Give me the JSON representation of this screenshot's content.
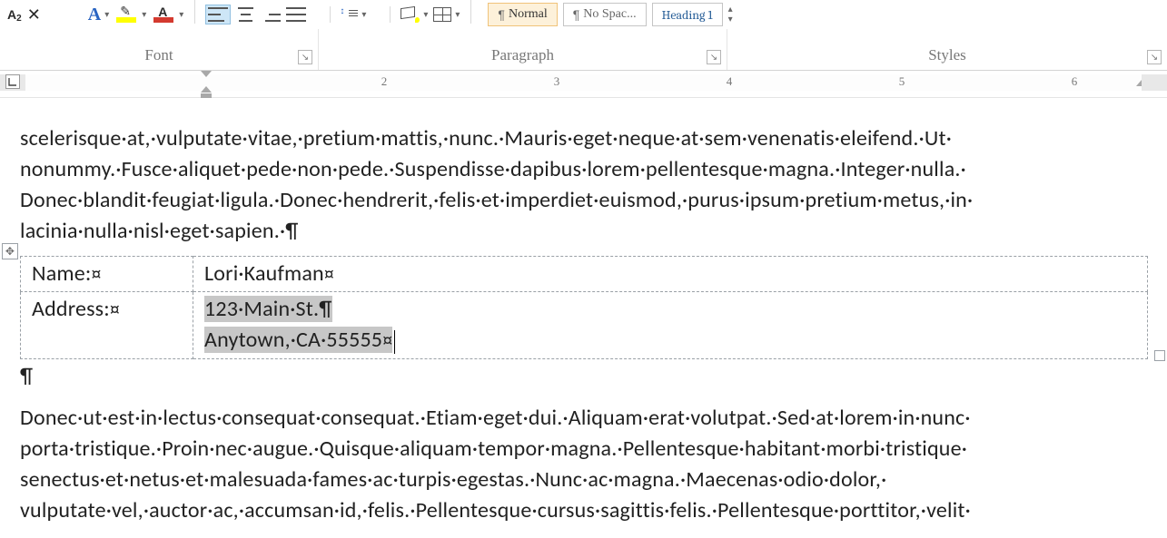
{
  "ribbon": {
    "groups": {
      "font": "Font",
      "paragraph": "Paragraph",
      "styles": "Styles"
    },
    "styles": {
      "normal": "Normal",
      "nospacing": "No Spac...",
      "heading1": "Heading 1",
      "para_symbol": "¶"
    }
  },
  "ruler": {
    "nums": [
      "2",
      "3",
      "4",
      "5",
      "6"
    ]
  },
  "document": {
    "para1_lines": [
      "scelerisque·at,·vulputate·vitae,·pretium·mattis,·nunc.·Mauris·eget·neque·at·sem·venenatis·eleifend.·Ut·",
      "nonummy.·Fusce·aliquet·pede·non·pede.·Suspendisse·dapibus·lorem·pellentesque·magna.·Integer·nulla.·",
      "Donec·blandit·feugiat·ligula.·Donec·hendrerit,·felis·et·imperdiet·euismod,·purus·ipsum·pretium·metus,·in·",
      "lacinia·nulla·nisl·eget·sapien.·"
    ],
    "table": {
      "rows": [
        {
          "label": "Name:",
          "value": [
            "Lori·Kaufman"
          ]
        },
        {
          "label": "Address:",
          "value": [
            "123·Main·St.",
            "Anytown,·CA·55555"
          ]
        }
      ]
    },
    "para2_lines": [
      "Donec·ut·est·in·lectus·consequat·consequat.·Etiam·eget·dui.·Aliquam·erat·volutpat.·Sed·at·lorem·in·nunc·",
      "porta·tristique.·Proin·nec·augue.·Quisque·aliquam·tempor·magna.·Pellentesque·habitant·morbi·tristique·",
      "senectus·et·netus·et·malesuada·fames·ac·turpis·egestas.·Nunc·ac·magna.·Maecenas·odio·dolor,·",
      "vulputate·vel,·auctor·ac,·accumsan·id,·felis.·Pellentesque·cursus·sagittis·felis.·Pellentesque·porttitor,·velit·"
    ]
  }
}
